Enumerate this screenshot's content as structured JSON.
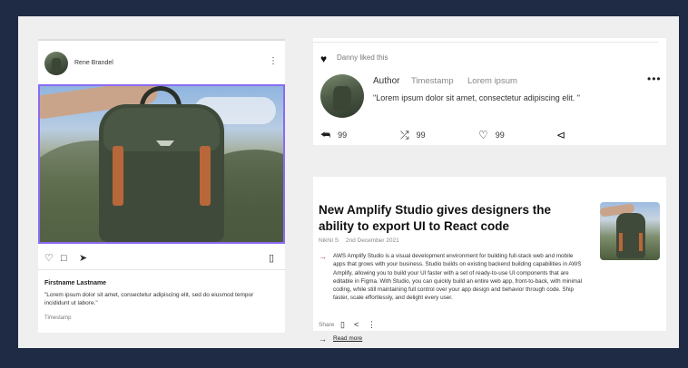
{
  "post_card": {
    "author_name": "Rene Brandel",
    "menu_icon": "vertical-dots-icon",
    "actions": [
      "heart-icon",
      "comment-icon",
      "send-icon",
      "bookmark-icon"
    ],
    "commenter_name": "Firstname Lastname",
    "comment_text": "\"Lorem ipsum dolor sit amet, consectetur adipiscing elit, sed do eiusmod tempor incididunt ut labore.\"",
    "timestamp": "Timestamp"
  },
  "social_card": {
    "liked_text": "Danny liked this",
    "author": "Author",
    "timestamp": "Timestamp",
    "lorem": "Lorem ipsum",
    "quote": "\"Lorem ipsum dolor sit amet, consectetur adipiscing elit. \"",
    "menu_icon": "horizontal-dots-icon",
    "stats": [
      {
        "icon": "reply-icon",
        "count": "99"
      },
      {
        "icon": "shuffle-icon",
        "count": "99"
      },
      {
        "icon": "heart-outline-icon",
        "count": "99"
      },
      {
        "icon": "share-icon",
        "count": ""
      }
    ]
  },
  "article_card": {
    "title": "New Amplify Studio gives designers the ability to export UI to React code",
    "author": "Nikhil S",
    "date": "2nd December 2021",
    "body": "AWS Amplify Studio is a visual development environment for building full-stack web and mobile apps that grows with your business. Studio builds on existing backend building capabilities in AWS Amplify, allowing you to build your UI faster with a set of ready-to-use UI components that are editable in Figma. With Studio, you can quickly build an entire web app, front-to-back, with minimal coding, while still maintaining full control over your app design and behavior through code. Ship faster, scale effortlessly, and delight every user.",
    "share_label": "Share",
    "read_more": "Read more",
    "accent_color": "#c03c8a"
  }
}
